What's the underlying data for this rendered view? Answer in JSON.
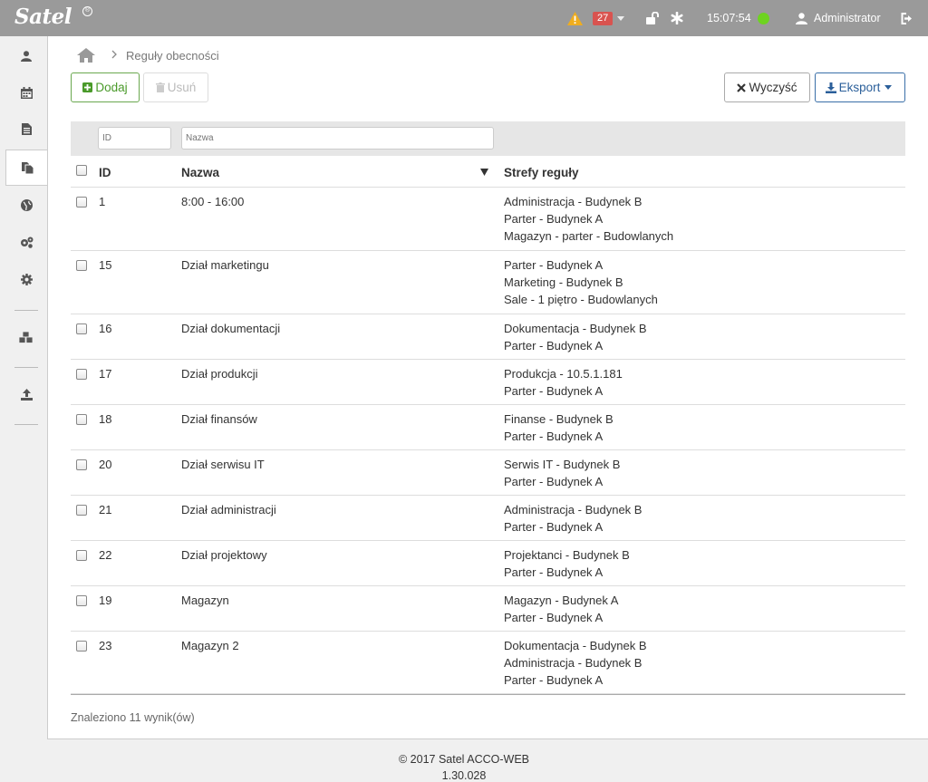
{
  "app": {
    "logo": "Satel",
    "logo_mark": "®"
  },
  "header": {
    "alert_count": "27",
    "time": "15:07:54",
    "user": "Administrator"
  },
  "breadcrumb": {
    "current": "Reguły obecności"
  },
  "toolbar": {
    "add_label": "Dodaj",
    "delete_label": "Usuń",
    "clear_label": "Wyczyść",
    "export_label": "Eksport"
  },
  "filters": {
    "id_placeholder": "ID",
    "name_placeholder": "Nazwa"
  },
  "table": {
    "columns": {
      "id": "ID",
      "name": "Nazwa",
      "zones": "Strefy reguły"
    },
    "rows": [
      {
        "id": "1",
        "name": "8:00 - 16:00",
        "zones": [
          "Administracja - Budynek B",
          "Parter - Budynek A",
          "Magazyn - parter - Budowlanych"
        ]
      },
      {
        "id": "15",
        "name": "Dział marketingu",
        "zones": [
          "Parter - Budynek A",
          "Marketing - Budynek B",
          "Sale - 1 piętro - Budowlanych"
        ]
      },
      {
        "id": "16",
        "name": "Dział dokumentacji",
        "zones": [
          "Dokumentacja - Budynek B",
          "Parter - Budynek A"
        ]
      },
      {
        "id": "17",
        "name": "Dział produkcji",
        "zones": [
          "Produkcja - 10.5.1.181",
          "Parter - Budynek A"
        ]
      },
      {
        "id": "18",
        "name": "Dział finansów",
        "zones": [
          "Finanse - Budynek B",
          "Parter - Budynek A"
        ]
      },
      {
        "id": "20",
        "name": "Dział serwisu IT",
        "zones": [
          "Serwis IT - Budynek B",
          "Parter - Budynek A"
        ]
      },
      {
        "id": "21",
        "name": "Dział administracji",
        "zones": [
          "Administracja - Budynek B",
          "Parter - Budynek A"
        ]
      },
      {
        "id": "22",
        "name": "Dział projektowy",
        "zones": [
          "Projektanci - Budynek B",
          "Parter - Budynek A"
        ]
      },
      {
        "id": "19",
        "name": "Magazyn",
        "zones": [
          "Magazyn - Budynek A",
          "Parter - Budynek A"
        ]
      },
      {
        "id": "23",
        "name": "Magazyn 2",
        "zones": [
          "Dokumentacja - Budynek B",
          "Administracja - Budynek B",
          "Parter - Budynek A"
        ]
      }
    ]
  },
  "results_text": "Znaleziono 11 wynik(ów)",
  "footer": {
    "copyright": "© 2017 Satel",
    "product": "ACCO-WEB",
    "version": "1.30.028"
  }
}
